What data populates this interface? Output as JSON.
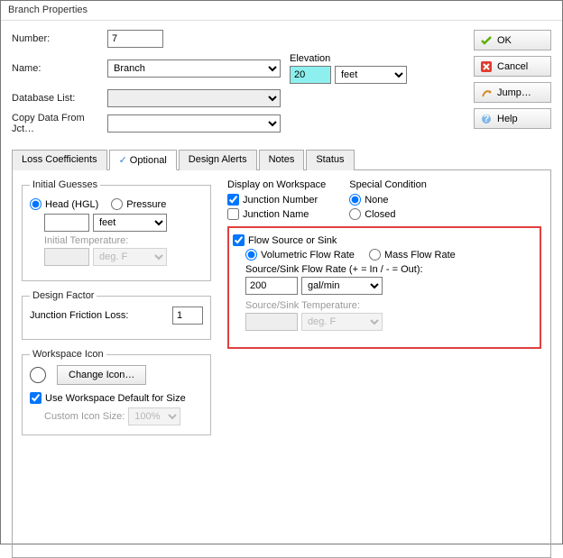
{
  "title": "Branch Properties",
  "buttons": {
    "ok": "OK",
    "cancel": "Cancel",
    "jump": "Jump…",
    "help": "Help"
  },
  "fields": {
    "number_label": "Number:",
    "number_value": "7",
    "name_label": "Name:",
    "name_value": "Branch",
    "dblist_label": "Database List:",
    "dblist_value": "",
    "copy_label": "Copy Data From Jct…",
    "copy_value": "",
    "elevation_label": "Elevation",
    "elevation_value": "20",
    "elevation_unit": "feet"
  },
  "tabs": {
    "loss": "Loss Coefficients",
    "optional": "Optional",
    "design": "Design Alerts",
    "notes": "Notes",
    "status": "Status"
  },
  "initial_guesses": {
    "legend": "Initial Guesses",
    "head": "Head (HGL)",
    "pressure": "Pressure",
    "value": "",
    "unit": "feet",
    "temp_label": "Initial Temperature:",
    "temp_value": "",
    "temp_unit": "deg. F"
  },
  "design_factor": {
    "legend": "Design Factor",
    "friction_label": "Junction Friction Loss:",
    "friction_value": "1"
  },
  "workspace_icon": {
    "legend": "Workspace Icon",
    "change": "Change Icon…",
    "use_default": "Use Workspace Default for Size",
    "custom_label": "Custom Icon Size:",
    "custom_value": "100%"
  },
  "display_ws": {
    "title": "Display on Workspace",
    "jnum": "Junction Number",
    "jname": "Junction Name"
  },
  "special": {
    "title": "Special Condition",
    "none": "None",
    "closed": "Closed"
  },
  "flow": {
    "enable": "Flow Source or Sink",
    "vol": "Volumetric Flow Rate",
    "mass": "Mass Flow Rate",
    "rate_label": "Source/Sink Flow Rate (+ = In / - = Out):",
    "rate_value": "200",
    "rate_unit": "gal/min",
    "temp_label": "Source/Sink Temperature:",
    "temp_value": "",
    "temp_unit": "deg. F"
  }
}
